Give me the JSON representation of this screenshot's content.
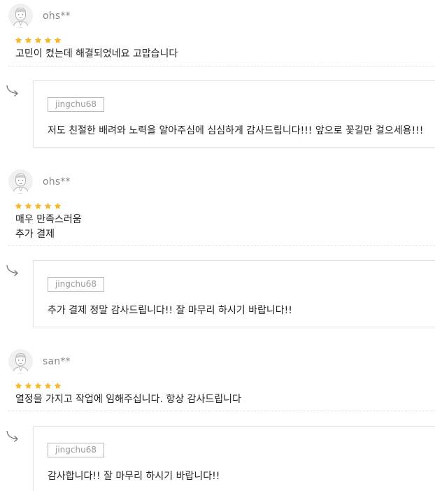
{
  "reviews": [
    {
      "username": "ohs**",
      "rating": 5,
      "text": "고민이 컸는데 해결되었네요 고맙습니다",
      "reply": {
        "seller": "jingchu68",
        "text": "저도 친절한 배려와 노력을 알아주심에 심심하게 감사드립니다!!! 앞으로 꽃길만 걸으세용!!!"
      }
    },
    {
      "username": "ohs**",
      "rating": 5,
      "text": "매우 만족스러움\n추가 결제",
      "reply": {
        "seller": "jingchu68",
        "text": "추가 결제 정말 감사드립니다!! 잘 마무리 하시기 바랍니다!!"
      }
    },
    {
      "username": "san**",
      "rating": 5,
      "text": "열정을 가지고 작업에 임해주십니다. 항상 감사드립니다",
      "reply": {
        "seller": "jingchu68",
        "text": "감사합니다!! 잘 마무리 하시기 바랍니다!!"
      }
    }
  ],
  "colors": {
    "star": "#f5b82e",
    "username": "#888888",
    "border": "#e2e2e2"
  },
  "icons": {
    "avatar": "user-avatar-icon",
    "star": "star-icon",
    "reply": "reply-arrow-icon"
  }
}
